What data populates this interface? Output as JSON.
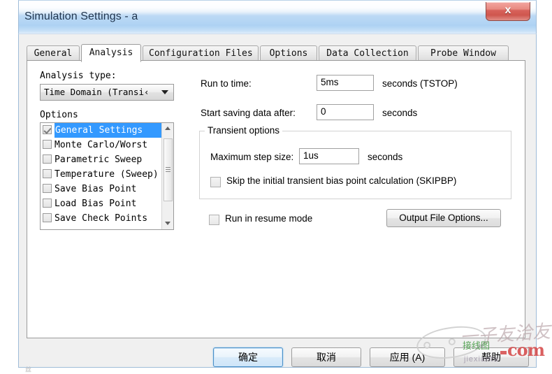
{
  "window": {
    "title": "Simulation Settings - a",
    "close_icon": "close-x-icon",
    "close_label": "x"
  },
  "tabs": [
    {
      "label": "General",
      "active": false
    },
    {
      "label": "Analysis",
      "active": true
    },
    {
      "label": "Configuration Files",
      "active": false
    },
    {
      "label": "Options",
      "active": false
    },
    {
      "label": "Data Collection",
      "active": false
    },
    {
      "label": "Probe Window",
      "active": false
    }
  ],
  "left_panel": {
    "analysis_type_label": "Analysis type:",
    "analysis_type_value": "Time Domain (Transi‹",
    "options_label": "Options",
    "options": [
      {
        "label": "General Settings",
        "checked": true,
        "selected": true
      },
      {
        "label": "Monte Carlo/Worst",
        "checked": false,
        "selected": false
      },
      {
        "label": "Parametric Sweep",
        "checked": false,
        "selected": false
      },
      {
        "label": "Temperature (Sweep)",
        "checked": false,
        "selected": false
      },
      {
        "label": "Save Bias Point",
        "checked": false,
        "selected": false
      },
      {
        "label": "Load Bias Point",
        "checked": false,
        "selected": false
      },
      {
        "label": "Save Check Points",
        "checked": false,
        "selected": false
      }
    ]
  },
  "right_panel": {
    "run_to_time_label": "Run to time:",
    "run_to_time_value": "5ms",
    "run_to_time_unit": "seconds  (TSTOP)",
    "start_saving_label": "Start saving data after:",
    "start_saving_value": "0",
    "start_saving_unit": "seconds",
    "transient_group_title": "Transient options",
    "max_step_label": "Maximum step size:",
    "max_step_value": "1us",
    "max_step_unit": "seconds",
    "skipbp_label": "Skip the initial transient bias point calculation  (SKIPBP)",
    "skipbp_checked": false,
    "resume_label": "Run in resume mode",
    "resume_checked": false,
    "output_file_options_label": "Output File Options..."
  },
  "footer": {
    "ok_label": "确定",
    "cancel_label": "取消",
    "apply_label": "应用 (A)",
    "help_label": "帮助"
  },
  "watermark": {
    "cn_text": "一子友洽友",
    "green_text": "接线图",
    "com_text": "com",
    "sub_text": "jiexiantu",
    "small_en": "er"
  },
  "artifact": {
    "text": "丝"
  },
  "colors": {
    "titlebar_blue": "#aed2f3",
    "selection_blue": "#3399ff",
    "close_red": "#d7615a",
    "dialog_gray": "#f0f0f0",
    "panel_white": "#ffffff"
  }
}
